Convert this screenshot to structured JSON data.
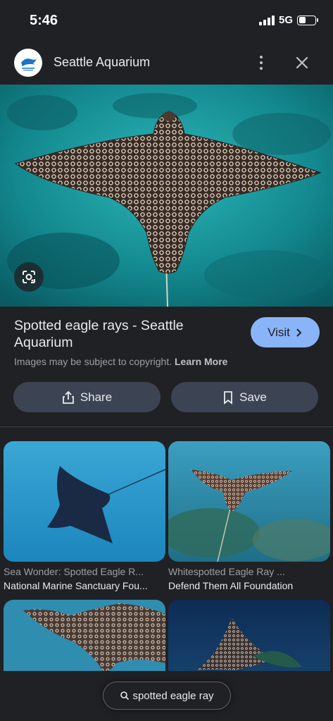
{
  "status_bar": {
    "time": "5:46",
    "network": "5G"
  },
  "header": {
    "site_name": "Seattle Aquarium"
  },
  "result": {
    "title": "Spotted eagle rays - Seattle Aquarium",
    "visit_label": "Visit",
    "copyright_text": "Images may be subject to copyright.",
    "learn_more": "Learn More",
    "share_label": "Share",
    "save_label": "Save"
  },
  "related": [
    {
      "title": "Sea Wonder: Spotted Eagle R...",
      "source": "National Marine Sanctuary Fou..."
    },
    {
      "title": "Whitespotted Eagle Ray ...",
      "source": "Defend Them All Foundation"
    }
  ],
  "search": {
    "query": "spotted eagle ray"
  },
  "colors": {
    "accent": "#8ab4f8",
    "background": "#202124",
    "button": "#3c4453"
  }
}
